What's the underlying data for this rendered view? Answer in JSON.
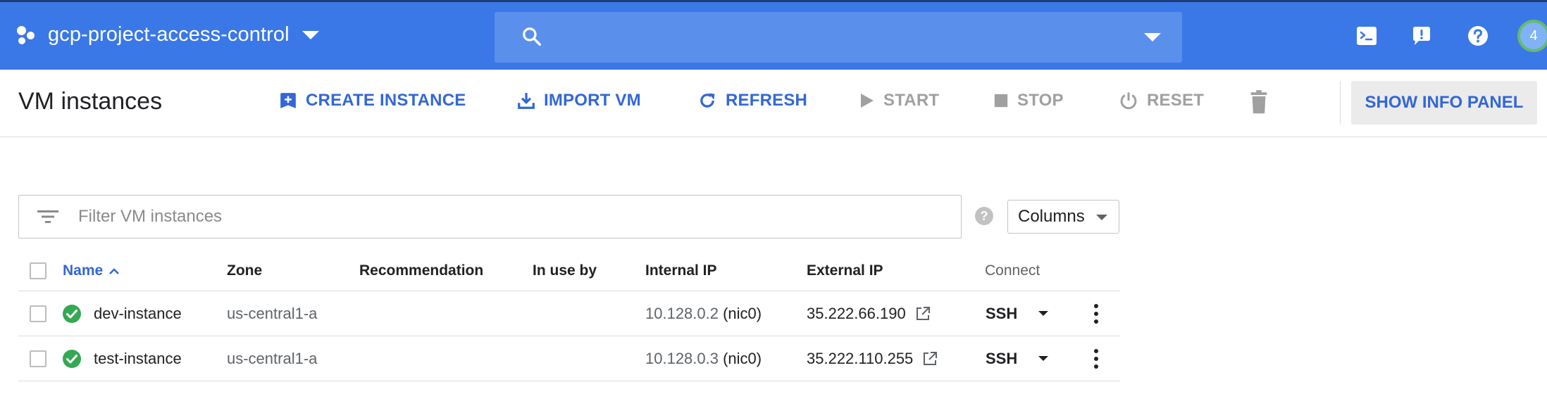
{
  "topbar": {
    "project_name": "gcp-project-access-control",
    "search_placeholder": "",
    "avatar_label": "4",
    "icons": [
      "project-logo-icon",
      "search-icon",
      "cloud-shell-icon",
      "notifications-icon",
      "help-icon"
    ],
    "colors": {
      "bar": "#3b78e7",
      "search": "#5a8fec"
    }
  },
  "toolbar": {
    "title": "VM instances",
    "create": "CREATE INSTANCE",
    "import": "IMPORT VM",
    "refresh": "REFRESH",
    "start": "START",
    "stop": "STOP",
    "reset": "RESET",
    "info_panel": "SHOW INFO PANEL",
    "accent": "#3367d6",
    "disabled_color": "#a0a0a0"
  },
  "filter": {
    "placeholder": "Filter VM instances",
    "columns_label": "Columns"
  },
  "table": {
    "headers": {
      "name": "Name",
      "zone": "Zone",
      "recommendation": "Recommendation",
      "in_use_by": "In use by",
      "internal_ip": "Internal IP",
      "external_ip": "External IP",
      "connect": "Connect"
    },
    "rows": [
      {
        "name": "dev-instance",
        "status": "running",
        "zone": "us-central1-a",
        "recommendation": "",
        "in_use_by": "",
        "internal_ip": "10.128.0.2",
        "nic": "(nic0)",
        "external_ip": "35.222.66.190",
        "connect": "SSH"
      },
      {
        "name": "test-instance",
        "status": "running",
        "zone": "us-central1-a",
        "recommendation": "",
        "in_use_by": "",
        "internal_ip": "10.128.0.3",
        "nic": "(nic0)",
        "external_ip": "35.222.110.255",
        "connect": "SSH"
      }
    ],
    "status_color": "#34a853"
  }
}
